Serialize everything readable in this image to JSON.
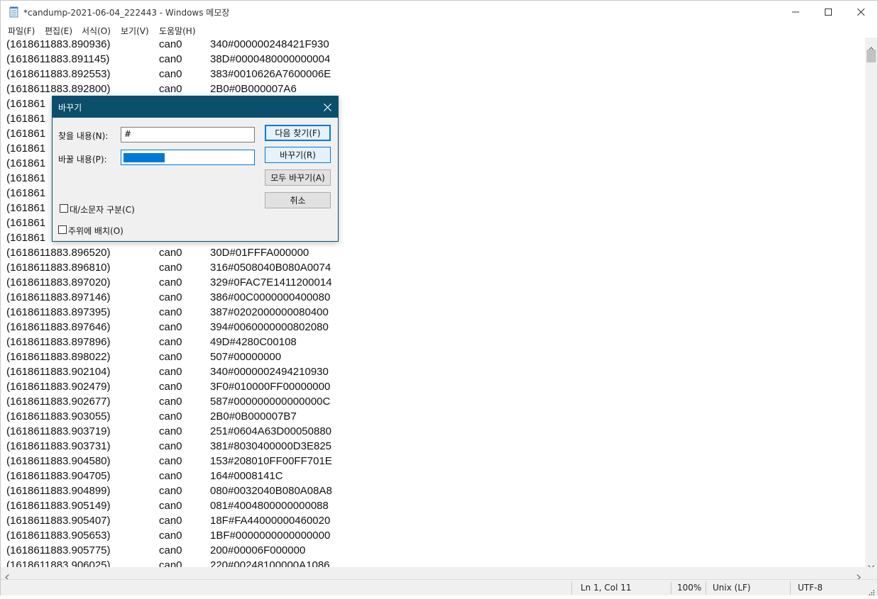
{
  "window": {
    "title": "*candump-2021-06-04_222443 - Windows 메모장",
    "icon": "notepad-icon",
    "controls": [
      "minimize-icon",
      "maximize-icon",
      "close-icon"
    ]
  },
  "menu": [
    "파일(F)",
    "편집(E)",
    "서식(O)",
    "보기(V)",
    "도움말(H)"
  ],
  "lines": [
    {
      "ts": "(1618611883.890936)",
      "iface": "can0",
      "data": "340#000000248421F930"
    },
    {
      "ts": "(1618611883.891145)",
      "iface": "can0",
      "data": "38D#0000480000000004"
    },
    {
      "ts": "(1618611883.892553)",
      "iface": "can0",
      "data": "383#0010626A7600006E"
    },
    {
      "ts": "(1618611883.892800)",
      "iface": "can0",
      "data": "2B0#0B000007A6"
    },
    {
      "ts": "(161861",
      "iface": "",
      "data": ""
    },
    {
      "ts": "(161861",
      "iface": "",
      "data": ""
    },
    {
      "ts": "(161861",
      "iface": "",
      "data": ""
    },
    {
      "ts": "(161861",
      "iface": "",
      "data": ""
    },
    {
      "ts": "(161861",
      "iface": "",
      "data": ""
    },
    {
      "ts": "(161861",
      "iface": "",
      "data": ""
    },
    {
      "ts": "(161861",
      "iface": "",
      "data": ""
    },
    {
      "ts": "(161861",
      "iface": "",
      "data": ""
    },
    {
      "ts": "(161861",
      "iface": "",
      "data": ""
    },
    {
      "ts": "(161861",
      "iface": "",
      "data": ""
    },
    {
      "ts": "(1618611883.896520)",
      "iface": "can0",
      "data": "30D#01FFFA000000"
    },
    {
      "ts": "(1618611883.896810)",
      "iface": "can0",
      "data": "316#0508040B080A0074"
    },
    {
      "ts": "(1618611883.897020)",
      "iface": "can0",
      "data": "329#0FAC7E1411200014"
    },
    {
      "ts": "(1618611883.897146)",
      "iface": "can0",
      "data": "386#00C0000000400080"
    },
    {
      "ts": "(1618611883.897395)",
      "iface": "can0",
      "data": "387#0202000000080400"
    },
    {
      "ts": "(1618611883.897646)",
      "iface": "can0",
      "data": "394#0060000000802080"
    },
    {
      "ts": "(1618611883.897896)",
      "iface": "can0",
      "data": "49D#4280C00108"
    },
    {
      "ts": "(1618611883.898022)",
      "iface": "can0",
      "data": "507#00000000"
    },
    {
      "ts": "(1618611883.902104)",
      "iface": "can0",
      "data": "340#0000002494210930"
    },
    {
      "ts": "(1618611883.902479)",
      "iface": "can0",
      "data": "3F0#010000FF00000000"
    },
    {
      "ts": "(1618611883.902677)",
      "iface": "can0",
      "data": "587#000000000000000C"
    },
    {
      "ts": "(1618611883.903055)",
      "iface": "can0",
      "data": "2B0#0B000007B7"
    },
    {
      "ts": "(1618611883.903719)",
      "iface": "can0",
      "data": "251#0604A63D00050880"
    },
    {
      "ts": "(1618611883.903731)",
      "iface": "can0",
      "data": "381#8030400000D3E825"
    },
    {
      "ts": "(1618611883.904580)",
      "iface": "can0",
      "data": "153#208010FF00FF701E"
    },
    {
      "ts": "(1618611883.904705)",
      "iface": "can0",
      "data": "164#0008141C"
    },
    {
      "ts": "(1618611883.904899)",
      "iface": "can0",
      "data": "080#0032040B080A08A8"
    },
    {
      "ts": "(1618611883.905149)",
      "iface": "can0",
      "data": "081#4004800000000088"
    },
    {
      "ts": "(1618611883.905407)",
      "iface": "can0",
      "data": "18F#FA44000000460020"
    },
    {
      "ts": "(1618611883.905653)",
      "iface": "can0",
      "data": "1BF#0000000000000000"
    },
    {
      "ts": "(1618611883.905775)",
      "iface": "can0",
      "data": "200#00006F000000"
    },
    {
      "ts": "(1618611883.906025)",
      "iface": "can0",
      "data": "220#00248100000A1086"
    }
  ],
  "status": {
    "position": "Ln 1, Col 11",
    "zoom": "100%",
    "line_ending": "Unix (LF)",
    "encoding": "UTF-8"
  },
  "dialog": {
    "title": "바꾸기",
    "find_label": "찾을 내용(N):",
    "find_value": "#",
    "replace_label": "바꿀 내용(P):",
    "replace_value": "",
    "buttons": {
      "find_next": "다음 찾기(F)",
      "replace": "바꾸기(R)",
      "replace_all": "모두 바꾸기(A)",
      "cancel": "취소"
    },
    "match_case": {
      "label": "대/소문자 구분(C)",
      "checked": false
    },
    "wrap_around": {
      "label": "주위에 배치(O)",
      "checked": false
    }
  }
}
